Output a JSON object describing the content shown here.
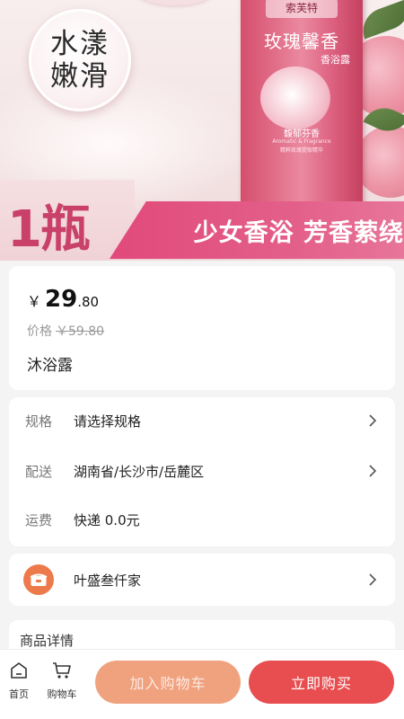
{
  "hero": {
    "badge_line1": "水漾",
    "badge_line2": "嫩滑",
    "bottle_brand": "索芙特",
    "bottle_title": "玫瑰馨香",
    "bottle_subtitle": "香浴露",
    "bottle_scent": "馥郁芬香",
    "bottle_scent_en": "Aromatic & Fragrance",
    "bottle_note": "精粹玫瑰提取精华",
    "promo_count": "1瓶",
    "promo_slogan": "少女香浴 芳香萦绕"
  },
  "price": {
    "currency": "￥",
    "integer": "29",
    "decimal": ".80",
    "original_label": "价格",
    "original_value": "￥59.80"
  },
  "product": {
    "name": "沐浴露"
  },
  "spec": {
    "rows": [
      {
        "label": "规格",
        "value": "请选择规格"
      },
      {
        "label": "配送",
        "value": "湖南省/长沙市/岳麓区"
      },
      {
        "label": "运费",
        "value": "快递 0.0元"
      }
    ]
  },
  "shop": {
    "name": "叶盛叁仟家",
    "logo_icon": "shop-icon"
  },
  "details": {
    "title": "商品详情"
  },
  "bottom_nav": {
    "home_label": "首页",
    "cart_label": "购物车",
    "add_to_cart_label": "加入购物车",
    "buy_now_label": "立即购买"
  },
  "colors": {
    "accent_pink": "#e14a7b",
    "add_to_cart": "#f0a27e",
    "buy_now": "#e84d4f",
    "shop_logo": "#ec7a4a"
  }
}
